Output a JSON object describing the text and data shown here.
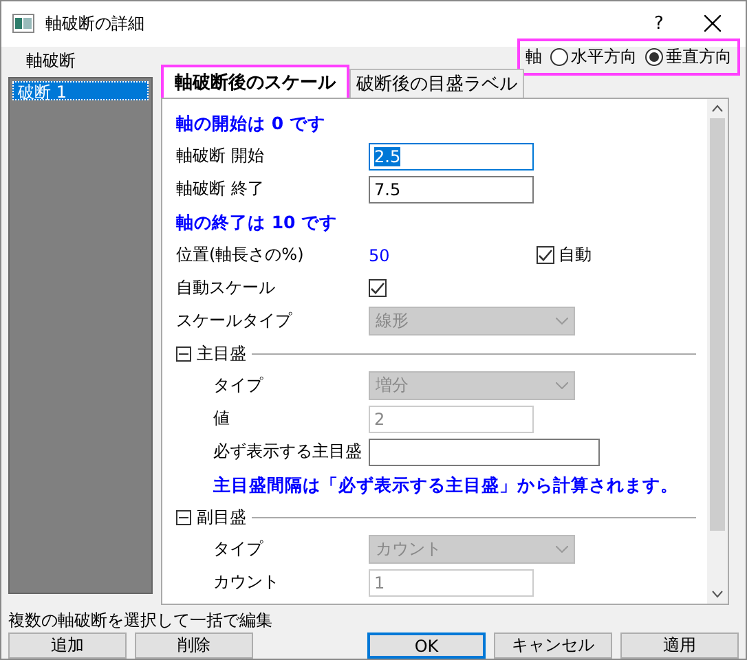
{
  "window": {
    "title": "軸破断の詳細",
    "help": "?"
  },
  "axis": {
    "label": "軸",
    "options": [
      {
        "label": "水平方向",
        "selected": false
      },
      {
        "label": "垂直方向",
        "selected": true
      }
    ]
  },
  "sidebar": {
    "heading": "軸破断",
    "items": [
      {
        "label": "破断 1",
        "selected": true
      }
    ]
  },
  "tabs": [
    {
      "label": "軸破断後のスケール",
      "selected": true
    },
    {
      "label": "破断後の目盛ラベル",
      "selected": false
    }
  ],
  "form": [
    {
      "kind": "note",
      "text": "軸の開始は 0 です"
    },
    {
      "kind": "input",
      "label": "軸破断 開始",
      "value": "2.5",
      "focused": true,
      "disabled": false
    },
    {
      "kind": "input",
      "label": "軸破断 終了",
      "value": "7.5",
      "focused": false,
      "disabled": false
    },
    {
      "kind": "note",
      "text": "軸の終了は 10 です"
    },
    {
      "kind": "readout",
      "label": "位置(軸長さの%)",
      "value": "50",
      "check_label": "自動",
      "checked": true
    },
    {
      "kind": "checkbox",
      "label": "自動スケール",
      "checked": true
    },
    {
      "kind": "select",
      "label": "スケールタイプ",
      "value": "線形",
      "disabled": true
    },
    {
      "kind": "section",
      "label": "主目盛",
      "expanded": true,
      "children": [
        {
          "kind": "select",
          "label": "タイプ",
          "value": "増分",
          "disabled": true
        },
        {
          "kind": "input",
          "label": "値",
          "value": "2",
          "focused": false,
          "disabled": true
        },
        {
          "kind": "input",
          "label": "必ず表示する主目盛",
          "focused": false,
          "disabled": false
        },
        {
          "kind": "note",
          "text": "主目盛間隔は「必ず表示する主目盛」から計算されます。"
        }
      ]
    },
    {
      "kind": "section",
      "label": "副目盛",
      "expanded": true,
      "children": [
        {
          "kind": "select",
          "label": "タイプ",
          "value": "カウント",
          "disabled": true
        },
        {
          "kind": "input",
          "label": "カウント",
          "value": "1",
          "focused": false,
          "disabled": true
        }
      ]
    }
  ],
  "status": "複数の軸破断を選択して一括で編集",
  "left_buttons": [
    {
      "label": "追加",
      "default": false
    },
    {
      "label": "削除",
      "default": false
    }
  ],
  "right_buttons": [
    {
      "label": "OK",
      "default": true
    },
    {
      "label": "キャンセル",
      "default": false
    },
    {
      "label": "適用",
      "default": false
    }
  ]
}
